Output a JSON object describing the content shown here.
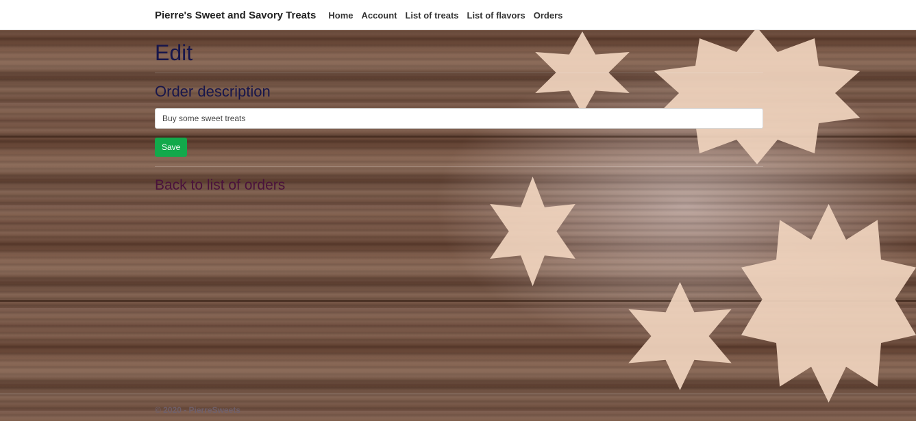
{
  "nav": {
    "brand": "Pierre's Sweet and Savory Treats",
    "links": [
      {
        "label": "Home"
      },
      {
        "label": "Account"
      },
      {
        "label": "List of treats"
      },
      {
        "label": "List of flavors"
      },
      {
        "label": "Orders"
      }
    ]
  },
  "main": {
    "title": "Edit",
    "section_title": "Order description",
    "description_input": {
      "value": "Buy some sweet treats",
      "placeholder": ""
    },
    "save_label": "Save",
    "back_link_label": "Back to list of orders"
  },
  "footer": {
    "text": "© 2020 - PierreSweets"
  },
  "colors": {
    "nav_bg": "#ffffff",
    "heading": "#17164b",
    "back_link": "#4a123b",
    "save_button": "#12a94b"
  }
}
